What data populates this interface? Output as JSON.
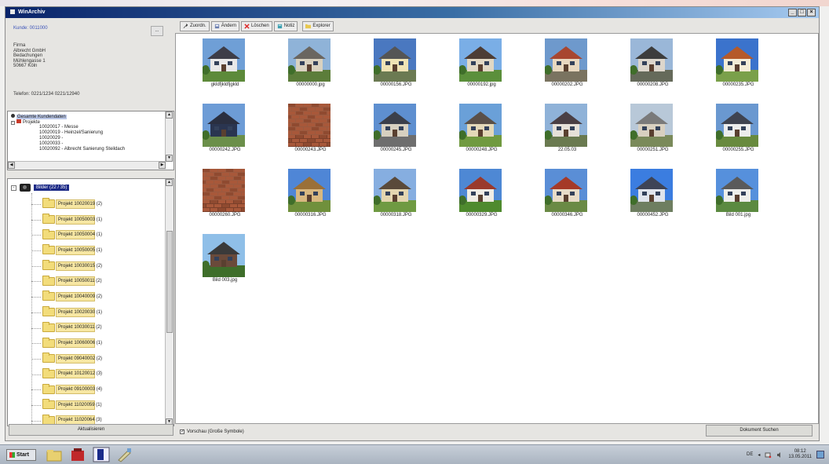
{
  "window": {
    "title": "WinArchiv"
  },
  "customer": {
    "kunde": "Kunde: 0011000",
    "button": "...",
    "address": [
      "Firma",
      "Albrecht GmbH",
      "Bedachungen",
      "Mühlengasse 1",
      "50667 Köln"
    ],
    "telefon": "Telefon: 0221/1234   0221/12940"
  },
  "tree_top": {
    "root": "Gesamte Kundendaten",
    "projekte": "Projekte",
    "items": [
      "10020017 - Messe",
      "10020019 - Heinzel/Sanierung",
      "10020029 -",
      "10020033 -",
      "10020092 - Albrecht Sanierung Steildach"
    ]
  },
  "tree_bottom": {
    "root": "Bilder (22 / 35)",
    "folders": [
      "Projekt 10020019 (2)",
      "Projekt 10050003 (1)",
      "Projekt 10050004 (1)",
      "Projekt 10050005 (1)",
      "Projekt 10030015 (2)",
      "Projekt 10050011 (2)",
      "Projekt 10040009 (2)",
      "Projekt 10020030 (1)",
      "Projekt 10030011 (2)",
      "Projekt 10060006 (1)",
      "Projekt 09040002 (2)",
      "Projekt 10120012 (3)",
      "Projekt 09100003 (4)",
      "Projekt 11020059 (1)",
      "Projekt 11020064 (3)"
    ]
  },
  "buttons": {
    "aktualisieren": "Aktualisieren",
    "suchen": "Dokument Suchen"
  },
  "toolbar": {
    "zuordn": "Zuordn.",
    "aendern": "Ändern",
    "loeschen": "Löschen",
    "notiz": "Notiz",
    "explorer": "Explorer"
  },
  "preview": {
    "label": "Vorschau (Große Symbole)",
    "checked": true
  },
  "thumbnails": [
    {
      "caption": "gkldfjkldfjgkld",
      "scene": 0
    },
    {
      "caption": "00000000.jpg",
      "scene": 1
    },
    {
      "caption": "00000156.JPG",
      "scene": 2
    },
    {
      "caption": "00000192.jpg",
      "scene": 3
    },
    {
      "caption": "00000202.JPG",
      "scene": 4
    },
    {
      "caption": "00000208.JPG",
      "scene": 5
    },
    {
      "caption": "00000235.JPG",
      "scene": 6
    },
    {
      "caption": "00000242.JPG",
      "scene": 7
    },
    {
      "caption": "00000243.JPG",
      "scene": 8
    },
    {
      "caption": "00000245.JPG",
      "scene": 9
    },
    {
      "caption": "00000248.JPG",
      "scene": 10
    },
    {
      "caption": "22.05.03",
      "scene": 11
    },
    {
      "caption": "00000251.JPG",
      "scene": 12
    },
    {
      "caption": "00000255.JPG",
      "scene": 13
    },
    {
      "caption": "00000260.JPG",
      "scene": 8
    },
    {
      "caption": "00000316.JPG",
      "scene": 14
    },
    {
      "caption": "00000318.JPG",
      "scene": 15
    },
    {
      "caption": "00000329.JPG",
      "scene": 16
    },
    {
      "caption": "00000346.JPG",
      "scene": 17
    },
    {
      "caption": "00000452.JPG",
      "scene": 18
    },
    {
      "caption": "Bild 001.jpg",
      "scene": 19
    },
    {
      "caption": "Bild 003.jpg",
      "scene": 20
    }
  ],
  "scene_palettes": [
    {
      "sky": "#6f9fd6",
      "ground": "#5d8a3a",
      "wall": "#e8e8e8",
      "roof": "#3d3d48"
    },
    {
      "sky": "#8fb3d8",
      "ground": "#5c7d3a",
      "wall": "#d9d2c0",
      "roof": "#6a6660"
    },
    {
      "sky": "#4a78c0",
      "ground": "#6b7a52",
      "wall": "#efe3b5",
      "roof": "#555555"
    },
    {
      "sky": "#7aaee6",
      "ground": "#5b8f3b",
      "wall": "#e2d8c4",
      "roof": "#4d3d35"
    },
    {
      "sky": "#6e99cc",
      "ground": "#7a7360",
      "wall": "#e8d8c0",
      "roof": "#a8462f"
    },
    {
      "sky": "#9ab7d8",
      "ground": "#656a5a",
      "wall": "#dcd6cc",
      "roof": "#3d3d3d"
    },
    {
      "sky": "#3b73cc",
      "ground": "#7aa04a",
      "wall": "#f3ecd6",
      "roof": "#b55a2a"
    },
    {
      "sky": "#6d9cd6",
      "ground": "#6b8f4a",
      "wall": "#2a3550",
      "roof": "#2a2f40"
    },
    {
      "sky": "#9a5a40",
      "ground": "#7a3f2a",
      "wall": "#a85a3c",
      "roof": "#8a4a33"
    },
    {
      "sky": "#5e8fd0",
      "ground": "#6e6e6e",
      "wall": "#d7d0c0",
      "roof": "#3b3f4a"
    },
    {
      "sky": "#6aa0d8",
      "ground": "#709a40",
      "wall": "#e3d8b8",
      "roof": "#5a5048"
    },
    {
      "sky": "#8fb2d8",
      "ground": "#6a7a50",
      "wall": "#e6e0d8",
      "roof": "#4a3f44"
    },
    {
      "sky": "#b8c8d8",
      "ground": "#7a8a5a",
      "wall": "#d8d0c0",
      "roof": "#7a7a7a"
    },
    {
      "sky": "#6a98d0",
      "ground": "#688a3e",
      "wall": "#ececec",
      "roof": "#3f4350"
    },
    {
      "sky": "#4f86d6",
      "ground": "#70903c",
      "wall": "#d8b880",
      "roof": "#9a7038"
    },
    {
      "sky": "#86aee0",
      "ground": "#6f9a42",
      "wall": "#e4d6b0",
      "roof": "#5a4a3a"
    },
    {
      "sky": "#4e88d4",
      "ground": "#4f8a2e",
      "wall": "#f0ece4",
      "roof": "#9a3a2c"
    },
    {
      "sky": "#5a8ed6",
      "ground": "#6a8a45",
      "wall": "#e8dcc8",
      "roof": "#a53a28"
    },
    {
      "sky": "#3b7de0",
      "ground": "#6e7e60",
      "wall": "#e0e4ec",
      "roof": "#3e4456"
    },
    {
      "sky": "#5690dc",
      "ground": "#5b8a40",
      "wall": "#eeeeea",
      "roof": "#5a5a5a"
    },
    {
      "sky": "#8fbfe8",
      "ground": "#3e6e2a",
      "wall": "#6a4a3a",
      "roof": "#3a3a3a"
    }
  ],
  "taskbar": {
    "start": "Start",
    "lang": "DE",
    "time": "08:12",
    "date": "13.05.2011"
  }
}
